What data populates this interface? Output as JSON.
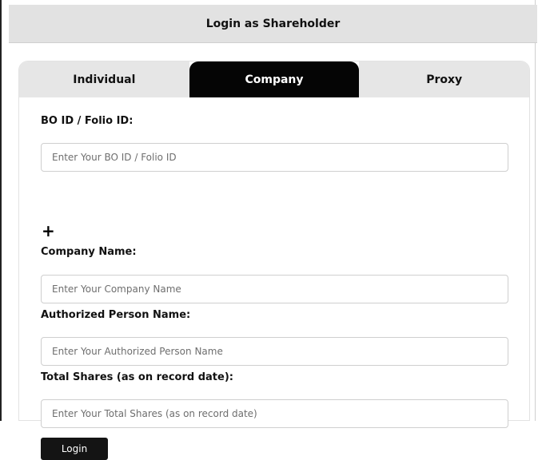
{
  "header": {
    "title": "Login as Shareholder"
  },
  "tabs": [
    {
      "label": "Individual",
      "active": false
    },
    {
      "label": "Company",
      "active": true
    },
    {
      "label": "Proxy",
      "active": false
    }
  ],
  "form": {
    "bo_id": {
      "label": "BO ID / Folio ID:",
      "placeholder": "Enter Your BO ID / Folio ID",
      "value": ""
    },
    "add_icon": "plus-icon",
    "company_name": {
      "label": "Company Name:",
      "placeholder": "Enter Your Company Name",
      "value": ""
    },
    "authorized_person": {
      "label": "Authorized Person Name:",
      "placeholder": "Enter Your Authorized Person Name",
      "value": ""
    },
    "total_shares": {
      "label": "Total Shares (as on record date):",
      "placeholder": "Enter Your Total Shares (as on record date)",
      "value": ""
    },
    "login_label": "Login"
  },
  "colors": {
    "header_bg": "#e2e2e2",
    "tab_active_bg": "#050505",
    "tab_inactive_bg": "#e6e6e6",
    "button_bg": "#141414"
  }
}
